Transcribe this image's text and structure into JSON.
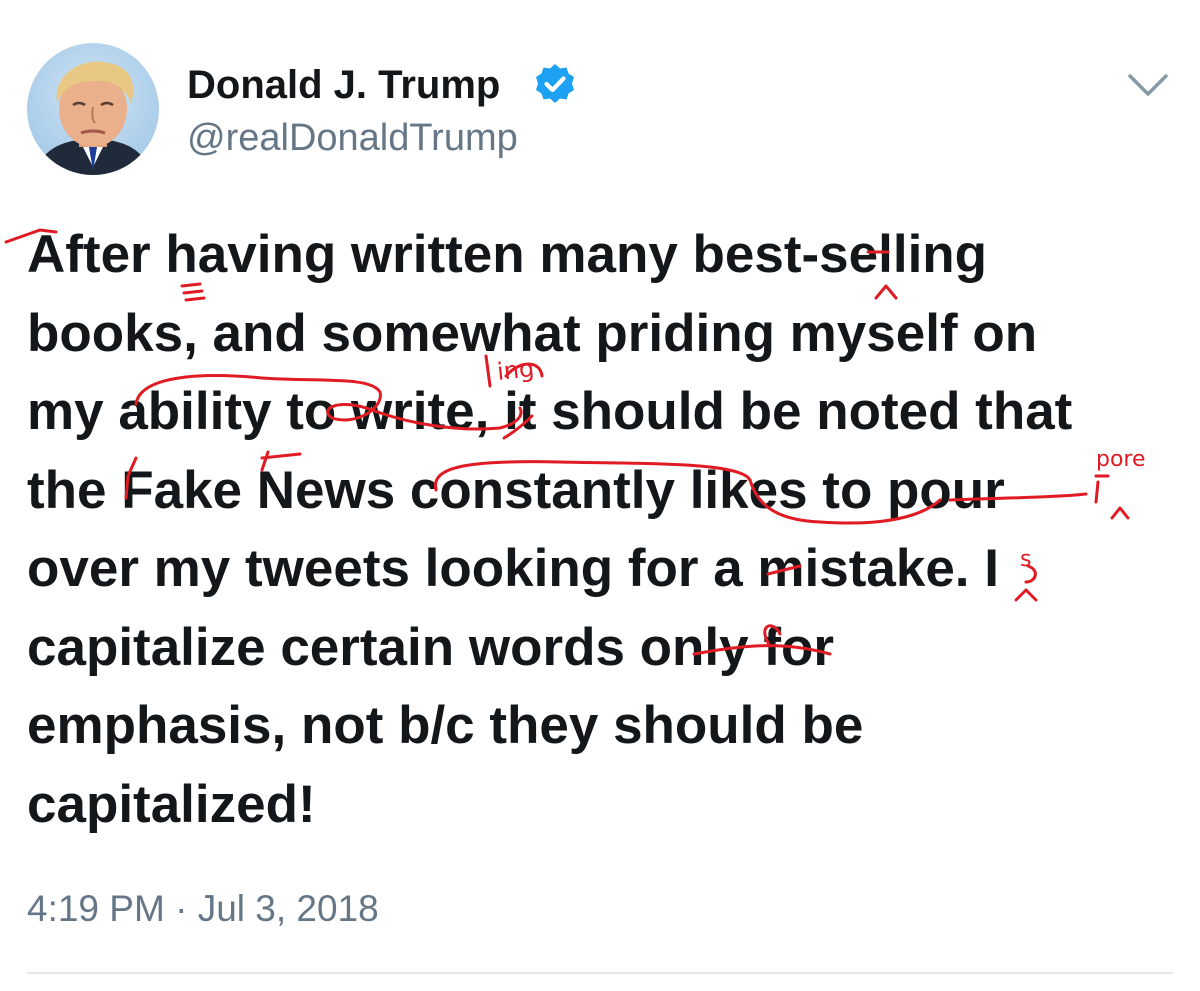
{
  "tweet": {
    "author": {
      "name": "Donald J. Trump",
      "handle": "@realDonaldTrump",
      "verified": true
    },
    "text_lines": [
      "After having written many best-selling",
      "books, and somewhat priding myself on",
      "my ability to write, it should be noted that",
      "the Fake News constantly likes to pour",
      "over my tweets looking for a mistake. I",
      "capitalize certain words only for",
      "emphasis, not b/c they should be",
      "capitalized!"
    ],
    "time": "4:19 PM",
    "separator": "·",
    "date": "Jul 3, 2018"
  },
  "handwritten_corrections": {
    "line3_insert": "ing",
    "line4_margin": "pore",
    "line5_insert": "s"
  },
  "colors": {
    "text": "#14171a",
    "secondary_text": "#657786",
    "verified_blue": "#1da1f2",
    "correction_red": "#e01b24",
    "divider": "#e1e8ed"
  },
  "icons": {
    "verified": "verified-badge-icon",
    "menu": "chevron-down-icon"
  }
}
